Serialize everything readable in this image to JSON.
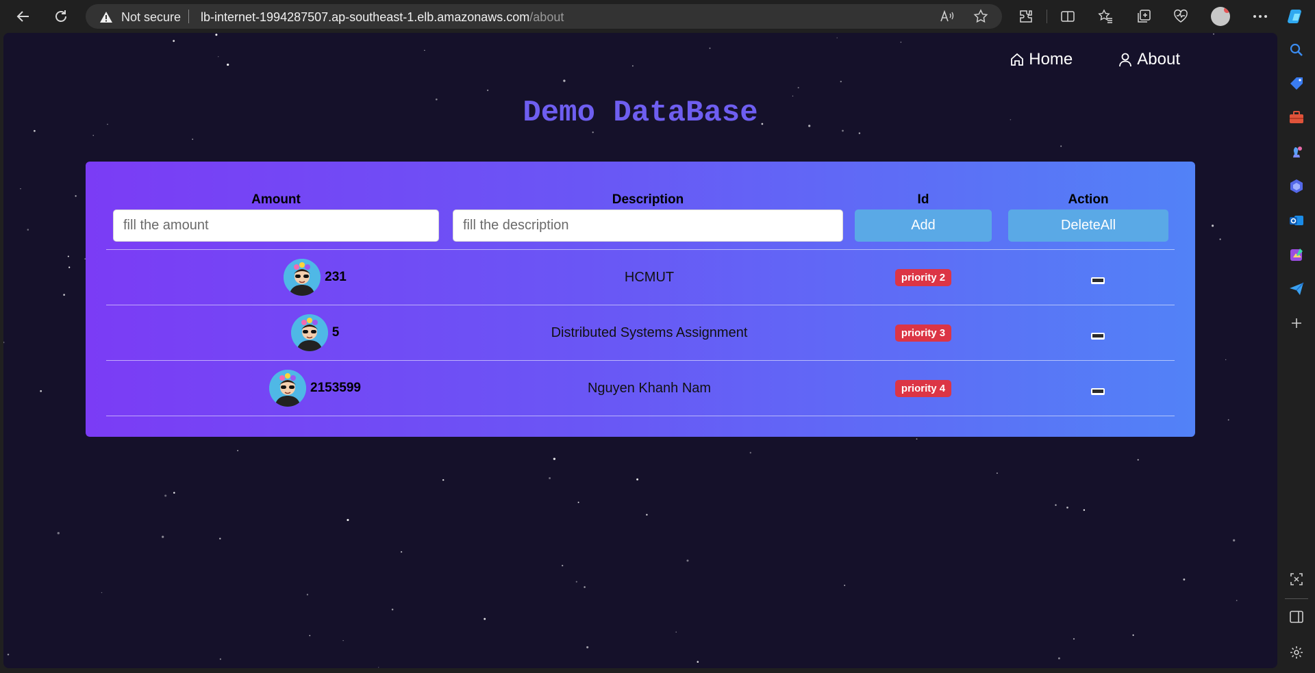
{
  "browser": {
    "security_label": "Not secure",
    "url_host": "lb-internet-1994287507.ap-southeast-1.elb.amazonaws.com",
    "url_path": "/about"
  },
  "site": {
    "nav": {
      "home_label": "Home",
      "about_label": "About"
    },
    "title": "Demo DataBase"
  },
  "form": {
    "headers": {
      "amount": "Amount",
      "description": "Description",
      "id": "Id",
      "action": "Action"
    },
    "amount_placeholder": "fill the amount",
    "description_placeholder": "fill the description",
    "add_label": "Add",
    "delete_all_label": "DeleteAll"
  },
  "rows": [
    {
      "amount": "231",
      "description": "HCMUT",
      "priority": "priority 2"
    },
    {
      "amount": "5",
      "description": "Distributed Systems Assignment",
      "priority": "priority 3"
    },
    {
      "amount": "2153599",
      "description": "Nguyen Khanh Nam",
      "priority": "priority 4"
    }
  ],
  "colors": {
    "background": "#15112a",
    "title": "#6e5ef0",
    "gradient_start": "#7b3cf5",
    "gradient_end": "#5282f7",
    "button": "#5aa9e6",
    "badge": "#dc3545"
  }
}
